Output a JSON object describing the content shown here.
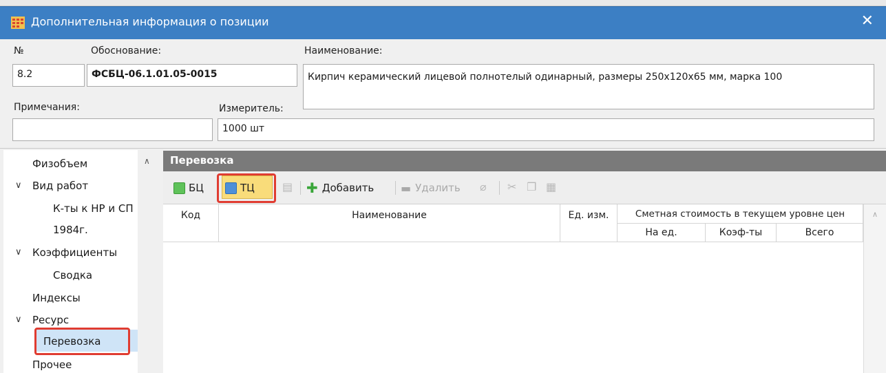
{
  "window": {
    "title": "Дополнительная информация о позиции",
    "close": "✕"
  },
  "form": {
    "number_label": "№",
    "number_value": "8.2",
    "basis_label": "Обоснование:",
    "basis_value": "ФСБЦ-06.1.01.05-0015",
    "name_label": "Наименование:",
    "name_value": "Кирпич керамический лицевой полнотелый одинарный, размеры 250х120х65 мм, марка 100",
    "notes_label": "Примечания:",
    "notes_value": "",
    "unit_label": "Измеритель:",
    "unit_value": "1000 шт"
  },
  "tree": {
    "items": [
      {
        "label": "Физобъем",
        "expandable": false
      },
      {
        "label": "Вид работ",
        "expandable": true
      },
      {
        "label": "К-ты к НР и СП",
        "expandable": false
      },
      {
        "label": "1984г.",
        "expandable": false
      },
      {
        "label": "Коэффициенты",
        "expandable": true
      },
      {
        "label": "Сводка",
        "expandable": false
      },
      {
        "label": "Индексы",
        "expandable": false
      },
      {
        "label": "Ресурс",
        "expandable": true
      },
      {
        "label": "Перевозка",
        "expandable": false,
        "selected": true
      },
      {
        "label": "Прочее",
        "expandable": false
      }
    ]
  },
  "panel": {
    "title": "Перевозка",
    "toolbar": {
      "bc_label": "БЦ",
      "tc_label": "ТЦ",
      "add_label": "Добавить",
      "delete_label": "Удалить"
    },
    "columns": {
      "code": "Код",
      "name": "Наименование",
      "unit": "Ед. изм.",
      "cost_group": "Сметная стоимость в текущем уровне цен",
      "per_unit": "На ед.",
      "coefs": "Коэф-ты",
      "total": "Всего"
    },
    "rows": []
  },
  "colors": {
    "titlebar": "#3c7fc4",
    "highlight": "#e03c31",
    "active_button": "#f9dc7a"
  }
}
